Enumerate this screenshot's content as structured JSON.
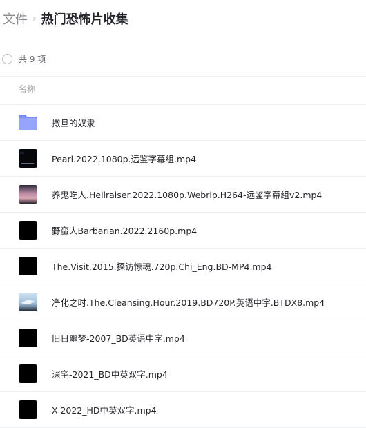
{
  "breadcrumb": {
    "root": "文件",
    "separator": "›",
    "current": "热门恐怖片收集"
  },
  "summary": {
    "count_text": "共 9 项"
  },
  "table": {
    "column_name": "名称"
  },
  "items": [
    {
      "name": "撒旦的奴隶",
      "type": "folder",
      "icon": "folder-icon"
    },
    {
      "name": "Pearl.2022.1080p.远鉴字幕组.mp4",
      "type": "video",
      "icon": "video-thumbnail-pearl"
    },
    {
      "name": "养鬼吃人.Hellraiser.2022.1080p.Webrip.H264-远鉴字幕组v2.mp4",
      "type": "video",
      "icon": "video-thumbnail-hellraiser"
    },
    {
      "name": "野蛮人Barbarian.2022.2160p.mp4",
      "type": "video",
      "icon": "video-thumbnail-black"
    },
    {
      "name": "The.Visit.2015.探访惊魂.720p.Chi_Eng.BD-MP4.mp4",
      "type": "video",
      "icon": "video-thumbnail-black"
    },
    {
      "name": "净化之时.The.Cleansing.Hour.2019.BD720P.英语中字.BTDX8.mp4",
      "type": "video",
      "icon": "video-thumbnail-cleansing"
    },
    {
      "name": "旧日噩梦-2007_BD英语中字.mp4",
      "type": "video",
      "icon": "video-thumbnail-black"
    },
    {
      "name": "深宅-2021_BD中英双字.mp4",
      "type": "video",
      "icon": "video-thumbnail-black"
    },
    {
      "name": "X-2022_HD中英双字.mp4",
      "type": "video",
      "icon": "video-thumbnail-black"
    }
  ],
  "colors": {
    "folder": "#8f9cf8",
    "divider": "#eceef1",
    "text_primary": "#25262b",
    "text_muted": "#8a8c93"
  }
}
